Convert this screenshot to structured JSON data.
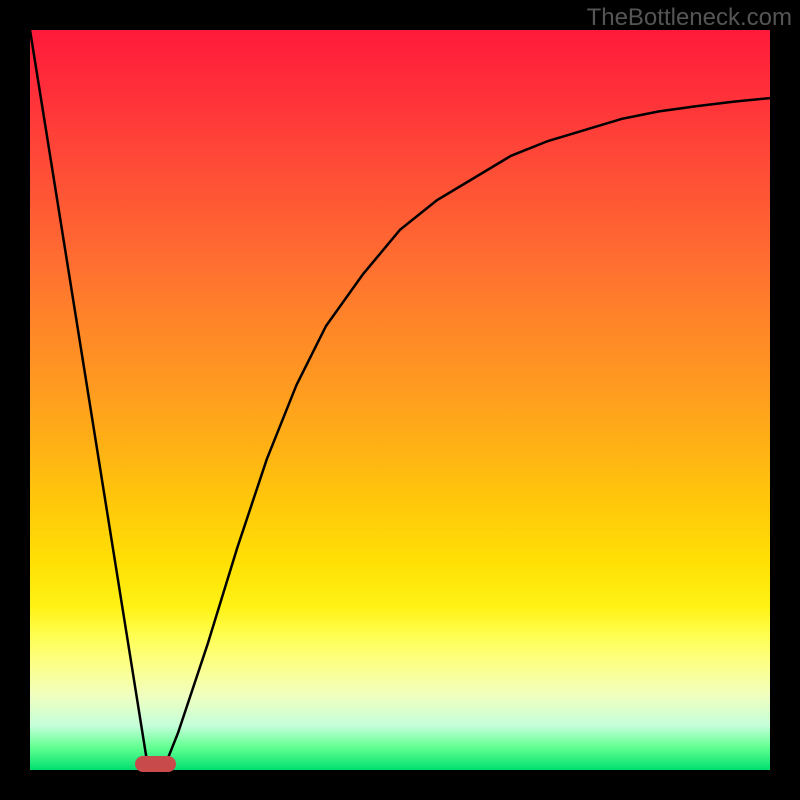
{
  "watermark": "TheBottleneck.com",
  "colors": {
    "frame": "#000000",
    "gradient_top": "#ff1a3a",
    "gradient_bottom": "#00e070",
    "curve": "#000000",
    "marker": "#c94a4b"
  },
  "chart_data": {
    "type": "line",
    "title": "",
    "xlabel": "",
    "ylabel": "",
    "xlim": [
      0,
      100
    ],
    "ylim": [
      0,
      100
    ],
    "grid": false,
    "legend": false,
    "series": [
      {
        "name": "left-line",
        "x": [
          0,
          16
        ],
        "y": [
          100,
          0
        ]
      },
      {
        "name": "right-curve",
        "x": [
          18,
          20,
          24,
          28,
          32,
          36,
          40,
          45,
          50,
          55,
          60,
          65,
          70,
          75,
          80,
          85,
          90,
          95,
          100
        ],
        "y": [
          0,
          5,
          17,
          30,
          42,
          52,
          60,
          67,
          73,
          77,
          80,
          83,
          85,
          86.5,
          88,
          89,
          89.7,
          90.3,
          90.8
        ]
      }
    ],
    "marker": {
      "x": 17,
      "y": 0.8,
      "width": 5.5,
      "height": 2.2
    }
  }
}
